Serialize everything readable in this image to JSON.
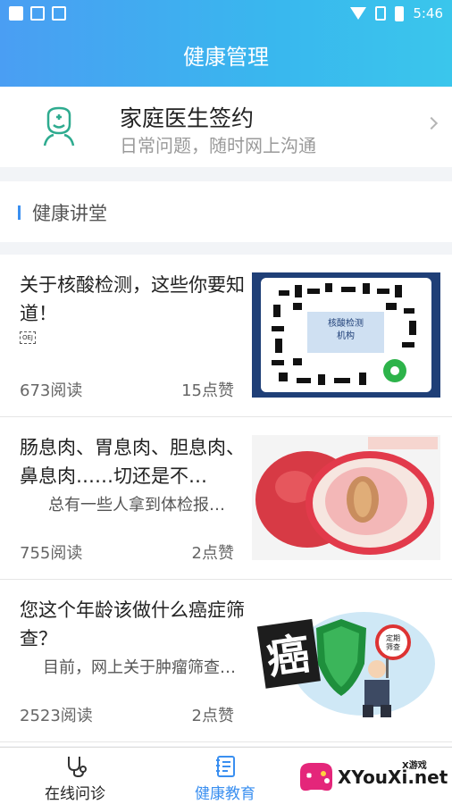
{
  "status_bar": {
    "time": "5:46"
  },
  "header": {
    "title": "健康管理"
  },
  "signin_card": {
    "title": "家庭医生签约",
    "subtitle": "日常问题，随时网上沟通"
  },
  "section": {
    "title": "健康讲堂"
  },
  "articles": [
    {
      "title": "关于核酸检测，这些你要知道！",
      "subtitle": "",
      "reads": "673阅读",
      "likes": "15点赞",
      "thumb_caption": "核酸检测机构"
    },
    {
      "title": "肠息肉、胃息肉、胆息肉、鼻息肉……切还是不…",
      "subtitle": "总有一些人拿到体检报…",
      "reads": "755阅读",
      "likes": "2点赞"
    },
    {
      "title": "您这个年龄该做什么癌症筛查？",
      "subtitle": "目前，网上关于肿瘤筛查…",
      "reads": "2523阅读",
      "likes": "2点赞",
      "thumb_text": "癌",
      "thumb_badge": "定期筛查"
    }
  ],
  "tabs": [
    {
      "label": "在线问诊",
      "active": false,
      "icon": "stethoscope-icon"
    },
    {
      "label": "健康教育",
      "active": true,
      "icon": "book-icon"
    }
  ],
  "watermark": {
    "text": "XYouXi.net",
    "small": "X游戏"
  },
  "colors": {
    "accent": "#3a8ff0",
    "icon_green": "#2eab8f"
  }
}
